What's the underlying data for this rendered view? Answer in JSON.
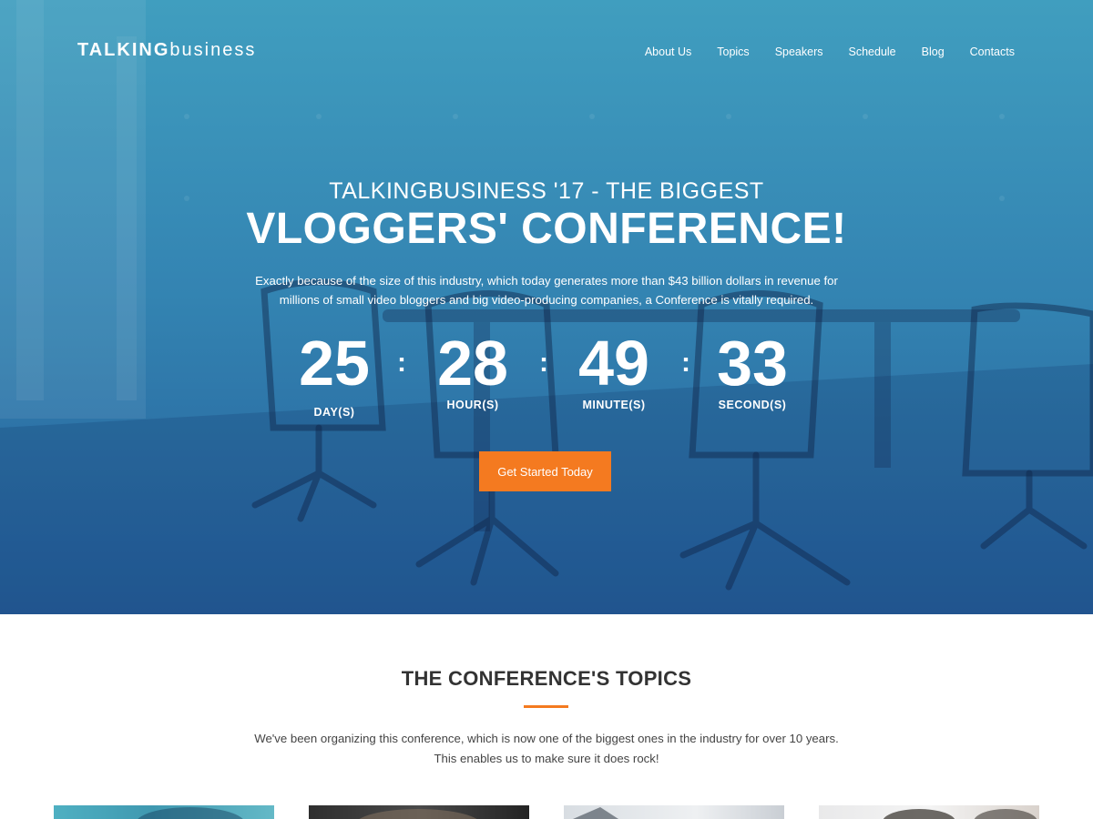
{
  "header": {
    "logo_bold": "TALKING",
    "logo_light": "business",
    "nav": [
      "About Us",
      "Topics",
      "Speakers",
      "Schedule",
      "Blog",
      "Contacts"
    ]
  },
  "hero": {
    "subtitle": "TALKINGBUSINESS '17 - THE BIGGEST",
    "title": "VLOGGERS' CONFERENCE!",
    "description": "Exactly because of the size of this industry, which today generates more than $43 billion dollars in revenue for millions of small video bloggers and big video-producing companies, a Conference is vitally required.",
    "countdown": {
      "days": "25",
      "days_label": "DAY(S)",
      "hours": "28",
      "hours_label": "HOUR(S)",
      "minutes": "49",
      "minutes_label": "MINUTE(S)",
      "seconds": "33",
      "seconds_label": "SECOND(S)",
      "separator": ":"
    },
    "cta_label": "Get Started Today"
  },
  "topics": {
    "title": "THE CONFERENCE'S TOPICS",
    "description_line1": "We've been organizing this conference, which is now one of the biggest ones in the industry for over 10 years.",
    "description_line2": "This enables us to make sure it does rock!"
  },
  "colors": {
    "accent": "#f47a20",
    "hero_top": "#3a9bbd",
    "hero_bottom": "#1f5a98"
  }
}
